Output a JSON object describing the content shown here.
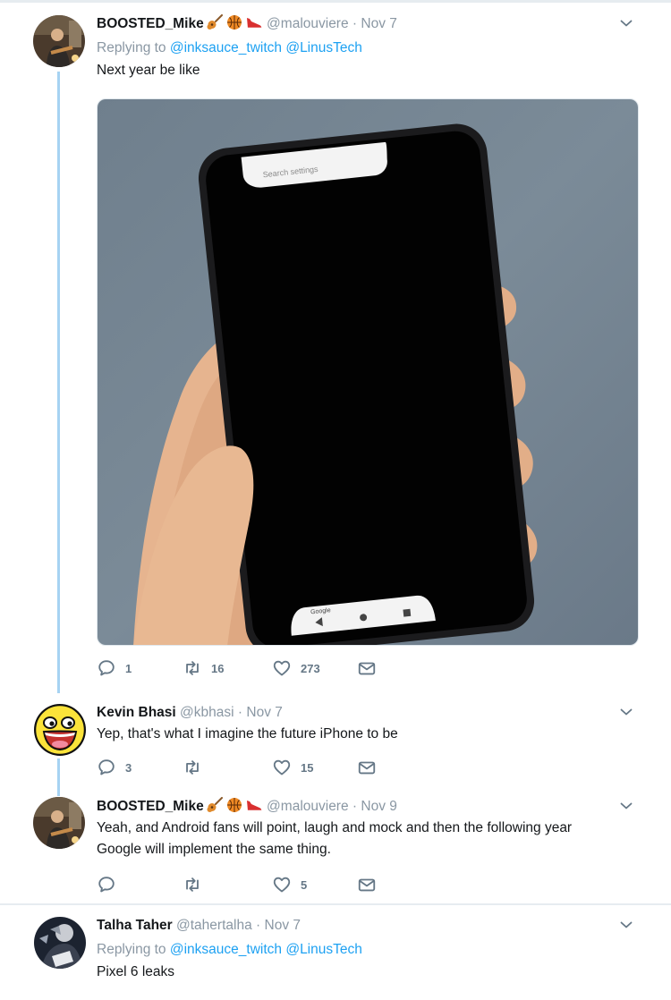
{
  "tweets": [
    {
      "name": "BOOSTED_Mike",
      "emojis": [
        "guitar",
        "basketball",
        "sneaker"
      ],
      "handle": "@malouviere",
      "dot": "·",
      "date": "Nov 7",
      "reply_prefix": "Replying to",
      "mentions": [
        "@inksauce_twitch",
        "@LinusTech"
      ],
      "text": "Next year be like",
      "media": {
        "screen_top_text": "Search settings",
        "screen_bottom_text": "Google"
      },
      "replies": "1",
      "retweets": "16",
      "likes": "273"
    },
    {
      "name": "Kevin Bhasi",
      "handle": "@kbhasi",
      "dot": "·",
      "date": "Nov 7",
      "text": "Yep, that's what I imagine the future iPhone to be",
      "replies": "3",
      "retweets": "",
      "likes": "15"
    },
    {
      "name": "BOOSTED_Mike",
      "emojis": [
        "guitar",
        "basketball",
        "sneaker"
      ],
      "handle": "@malouviere",
      "dot": "·",
      "date": "Nov 9",
      "text_line1": "Yeah, and Android fans will point, laugh and mock and then the following year",
      "text_line2": "Google will implement the same thing.",
      "replies": "",
      "retweets": "",
      "likes": "5"
    },
    {
      "name": "Talha Taher",
      "handle": "@tahertalha",
      "dot": "·",
      "date": "Nov 7",
      "reply_prefix": "Replying to",
      "mentions": [
        "@inksauce_twitch",
        "@LinusTech"
      ],
      "text": "Pixel 6 leaks"
    }
  ],
  "icons": {
    "reply": "reply-icon",
    "retweet": "retweet-icon",
    "like": "heart-icon",
    "dm": "envelope-icon",
    "more": "chevron-down-icon"
  },
  "colors": {
    "accent": "#1da1f2",
    "thread_line": "#a6d3f2",
    "muted": "#8a97a3",
    "action": "#657786"
  }
}
